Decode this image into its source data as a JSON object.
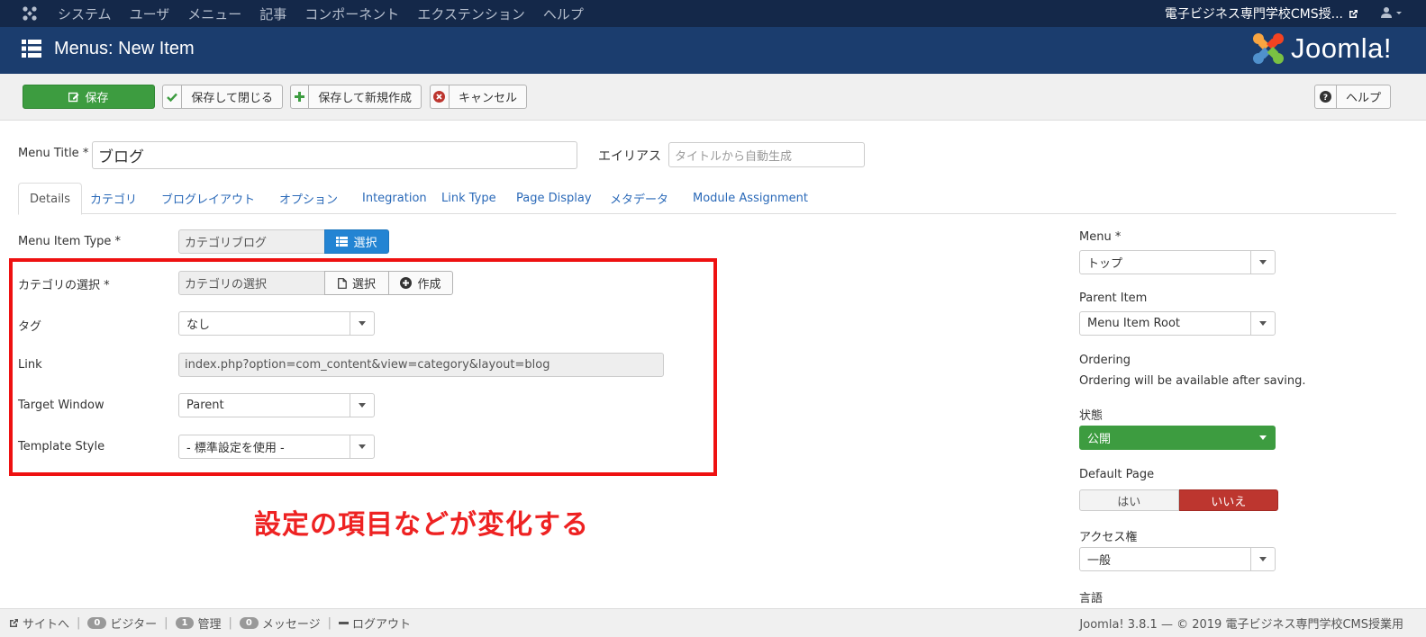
{
  "topbar": {
    "menu": [
      "システム",
      "ユーザ",
      "メニュー",
      "記事",
      "コンポーネント",
      "エクステンション",
      "ヘルプ"
    ],
    "site_name": "電子ビジネス専門学校CMS授..."
  },
  "titlebar": {
    "title": "Menus: New Item",
    "brand": "Joomla!"
  },
  "toolbar": {
    "save": "保存",
    "save_close": "保存して閉じる",
    "save_new": "保存して新規作成",
    "cancel": "キャンセル",
    "help": "ヘルプ"
  },
  "header": {
    "menu_title_label": "Menu Title *",
    "menu_title_value": "ブログ",
    "alias_label": "エイリアス",
    "alias_placeholder": "タイトルから自動生成"
  },
  "tabs": [
    "Details",
    "カテゴリ",
    "ブログレイアウト",
    "オプション",
    "Integration",
    "Link Type",
    "Page Display",
    "メタデータ",
    "Module Assignment"
  ],
  "details": {
    "menu_item_type_label": "Menu Item Type *",
    "menu_item_type_value": "カテゴリブログ",
    "select_button": "選択",
    "category_label": "カテゴリの選択 *",
    "category_value": "カテゴリの選択",
    "category_select": "選択",
    "category_create": "作成",
    "tag_label": "タグ",
    "tag_value": "なし",
    "link_label": "Link",
    "link_value": "index.php?option=com_content&view=category&layout=blog",
    "target_label": "Target Window",
    "target_value": "Parent",
    "template_label": "Template Style",
    "template_value": "- 標準設定を使用 -"
  },
  "annotation": "設定の項目などが変化する",
  "sidebar": {
    "menu_label": "Menu *",
    "menu_value": "トップ",
    "parent_label": "Parent Item",
    "parent_value": "Menu Item Root",
    "ordering_label": "Ordering",
    "ordering_text": "Ordering will be available after saving.",
    "status_label": "状態",
    "status_value": "公開",
    "default_label": "Default Page",
    "default_yes": "はい",
    "default_no": "いいえ",
    "access_label": "アクセス権",
    "access_value": "一般",
    "language_label": "言語"
  },
  "footer": {
    "site": "サイトへ",
    "visitors_count": "0",
    "visitors": "ビジター",
    "admin_count": "1",
    "admin": "管理",
    "messages_count": "0",
    "messages": "メッセージ",
    "logout": "ログアウト",
    "version": "Joomla! 3.8.1 — © 2019 電子ビジネス専門学校CMS授業用"
  },
  "colors": {
    "topbar": "#142849",
    "titlebar": "#1b3d6e",
    "save_green": "#3d9c40",
    "select_blue": "#2384d3",
    "no_red": "#bd362f",
    "annotation_red": "#ee1111"
  }
}
